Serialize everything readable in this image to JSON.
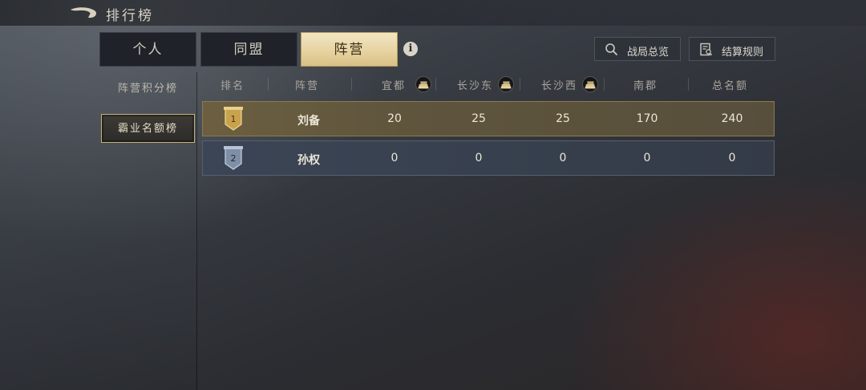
{
  "header": {
    "title": "排行榜"
  },
  "tabs": [
    {
      "label": "个人"
    },
    {
      "label": "同盟"
    },
    {
      "label": "阵营",
      "active": true
    }
  ],
  "sidebar": {
    "items": [
      {
        "label": "阵营积分榜"
      },
      {
        "label": "霸业名额榜",
        "active": true
      }
    ]
  },
  "actions": {
    "overview_label": "战局总览",
    "rules_label": "结算规则"
  },
  "table": {
    "columns": [
      "排名",
      "阵营",
      "宜都",
      "长沙东",
      "长沙西",
      "南郡",
      "总名额"
    ],
    "rows": [
      {
        "rank": "1",
        "faction": "刘备",
        "yidu": "20",
        "changsha_east": "25",
        "changsha_west": "25",
        "nanjun": "170",
        "total": "240"
      },
      {
        "rank": "2",
        "faction": "孙权",
        "yidu": "0",
        "changsha_east": "0",
        "changsha_west": "0",
        "nanjun": "0",
        "total": "0"
      }
    ]
  },
  "colors": {
    "accent_gold": "#e6d3a1",
    "row_gold": "#6c5f41",
    "row_blue": "#3b4555"
  },
  "icons": {
    "back": "back-arrow-icon",
    "info": "info-icon",
    "overview": "search-icon",
    "rules": "document-icon",
    "city_reward": "coin-stack-icon",
    "rank_gold": "gold-banner-badge-icon",
    "rank_silver": "silver-banner-badge-icon"
  }
}
